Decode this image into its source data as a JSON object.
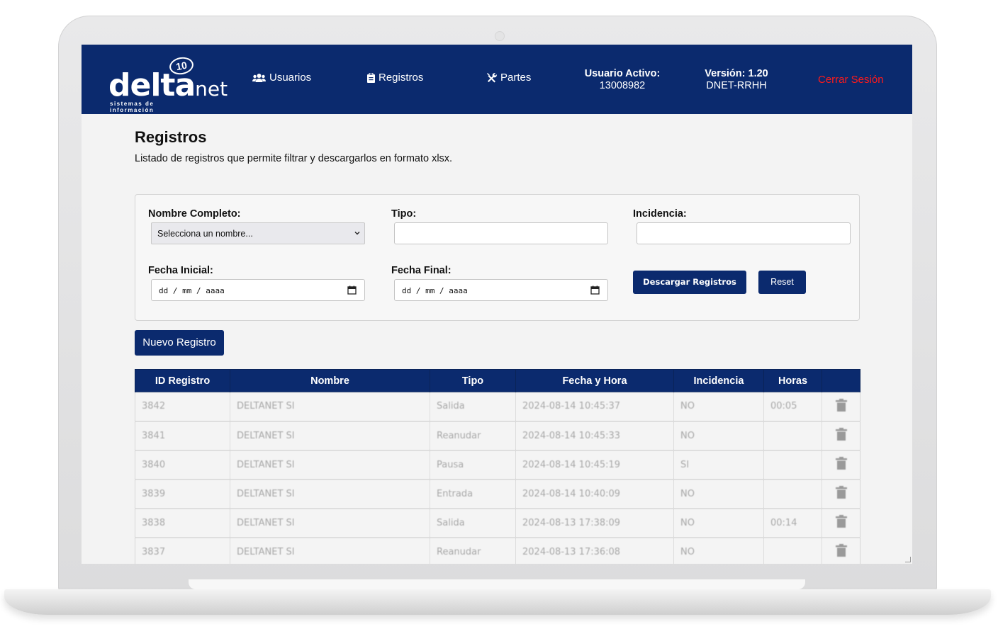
{
  "nav": {
    "logo": {
      "brand": "delta",
      "brand_suffix": "net",
      "badge": "10",
      "tagline": "sistemas de información"
    },
    "items": [
      {
        "label": "Usuarios",
        "icon": "users-icon"
      },
      {
        "label": "Registros",
        "icon": "clipboard-icon"
      },
      {
        "label": "Partes",
        "icon": "tools-icon"
      }
    ],
    "active_user_label": "Usuario Activo:",
    "active_user_value": "13008982",
    "version_label": "Versión: 1.20",
    "version_value": "DNET-RRHH",
    "logout_label": "Cerrar Sesión"
  },
  "page": {
    "title": "Registros",
    "description": "Listado de registros que permite filtrar y descargarlos en formato xlsx."
  },
  "filters": {
    "name_label": "Nombre Completo:",
    "name_selected": "Selecciona un nombre...",
    "type_label": "Tipo:",
    "type_value": "",
    "incidence_label": "Incidencia:",
    "incidence_value": "",
    "start_label": "Fecha Inicial:",
    "start_placeholder": "dd / mm / aaaa",
    "end_label": "Fecha Final:",
    "end_placeholder": "dd / mm / aaaa",
    "download_label": "Descargar Registros",
    "reset_label": "Reset"
  },
  "new_record_label": "Nuevo Registro",
  "table": {
    "headers": [
      "ID Registro",
      "Nombre",
      "Tipo",
      "Fecha y Hora",
      "Incidencia",
      "Horas",
      ""
    ],
    "rows": [
      {
        "id": "3842",
        "name": "DELTANET SI",
        "type": "Salida",
        "datetime": "2024-08-14 10:45:37",
        "incidence": "NO",
        "hours": "00:05"
      },
      {
        "id": "3841",
        "name": "DELTANET SI",
        "type": "Reanudar",
        "datetime": "2024-08-14 10:45:33",
        "incidence": "NO",
        "hours": ""
      },
      {
        "id": "3840",
        "name": "DELTANET SI",
        "type": "Pausa",
        "datetime": "2024-08-14 10:45:19",
        "incidence": "SI",
        "hours": ""
      },
      {
        "id": "3839",
        "name": "DELTANET SI",
        "type": "Entrada",
        "datetime": "2024-08-14 10:40:09",
        "incidence": "NO",
        "hours": ""
      },
      {
        "id": "3838",
        "name": "DELTANET SI",
        "type": "Salida",
        "datetime": "2024-08-13 17:38:09",
        "incidence": "NO",
        "hours": "00:14"
      },
      {
        "id": "3837",
        "name": "DELTANET SI",
        "type": "Reanudar",
        "datetime": "2024-08-13 17:36:08",
        "incidence": "NO",
        "hours": ""
      }
    ]
  },
  "colors": {
    "primary": "#0b2a6e",
    "logout": "#ff1a1a",
    "background": "#f3f3f3"
  }
}
